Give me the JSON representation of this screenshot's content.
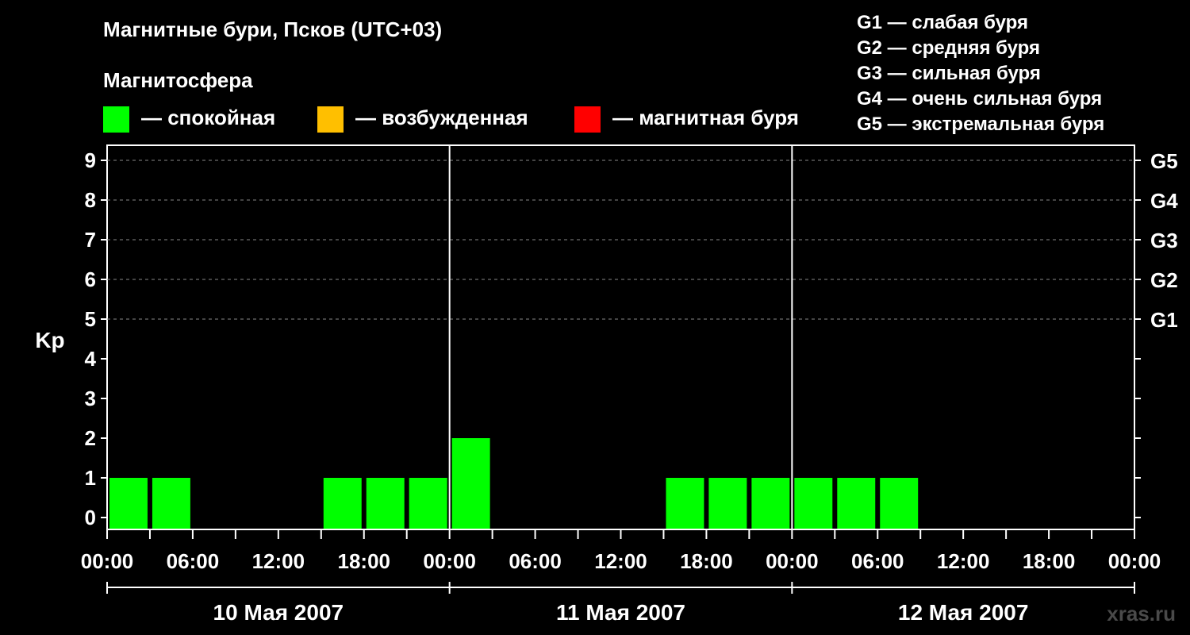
{
  "header": {
    "title": "Магнитные бури, Псков (UTC+03)",
    "subtitle": "Магнитосфера"
  },
  "legend": [
    {
      "color": "#00ff00",
      "label": "— спокойная"
    },
    {
      "color": "#ffbf00",
      "label": "— возбужденная"
    },
    {
      "color": "#ff0000",
      "label": "— магнитная буря"
    }
  ],
  "g_legend": [
    "G1 — слабая буря",
    "G2 — средняя буря",
    "G3 — сильная буря",
    "G4 — очень сильная буря",
    "G5 — экстремальная буря"
  ],
  "brand": "xras.ru",
  "chart_data": {
    "type": "bar",
    "ylabel": "Kp",
    "ylim": [
      0,
      9
    ],
    "y_ticks": [
      "0",
      "1",
      "2",
      "3",
      "4",
      "5",
      "6",
      "7",
      "8",
      "9"
    ],
    "right_labels": [
      {
        "value": 5,
        "label": "G1"
      },
      {
        "value": 6,
        "label": "G2"
      },
      {
        "value": 7,
        "label": "G3"
      },
      {
        "value": 8,
        "label": "G4"
      },
      {
        "value": 9,
        "label": "G5"
      }
    ],
    "x_tick_labels": [
      "00:00",
      "06:00",
      "12:00",
      "18:00",
      "00:00",
      "06:00",
      "12:00",
      "18:00",
      "00:00",
      "06:00",
      "12:00",
      "18:00",
      "00:00"
    ],
    "days": [
      "10 Мая 2007",
      "11 Мая 2007",
      "12 Мая 2007"
    ],
    "interval_hours": 3,
    "bar_color": "#00ff00",
    "values": [
      1,
      1,
      0,
      0,
      0,
      1,
      1,
      1,
      2,
      0,
      0,
      0,
      0,
      1,
      1,
      1,
      1,
      1,
      1,
      0,
      0,
      0,
      0,
      0
    ],
    "grid": "dashed at 5–9"
  }
}
